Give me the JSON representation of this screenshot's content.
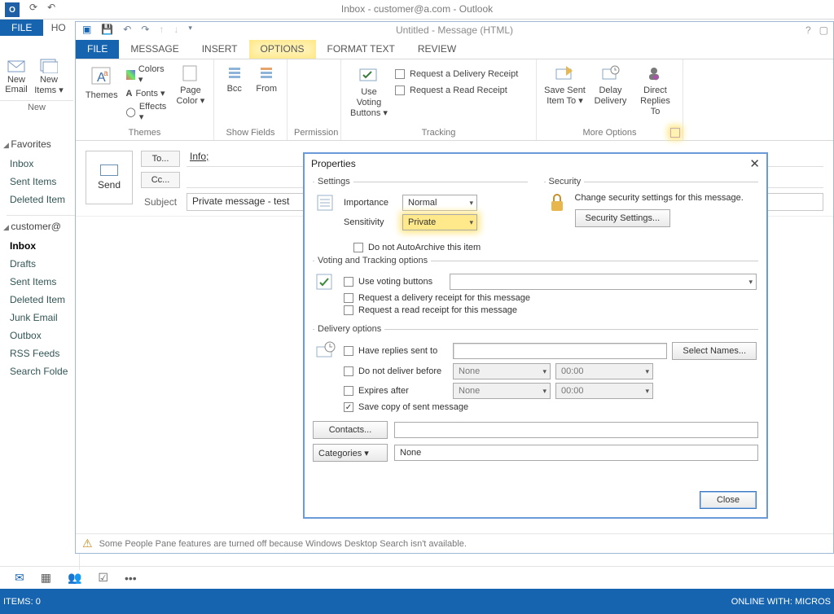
{
  "main_window": {
    "title": "Inbox - customer@a.com - Outlook",
    "file_tab": "FILE",
    "home_tab_fragment": "HO",
    "new_group_label": "New",
    "new_email": "New Email",
    "new_items": "New Items ▾"
  },
  "sidebar": {
    "favorites": "Favorites",
    "fav_items": [
      "Inbox",
      "Sent Items",
      "Deleted Item"
    ],
    "account": "customer@",
    "acct_items": [
      "Inbox",
      "Drafts",
      "Sent Items",
      "Deleted Item",
      "Junk Email",
      "Outbox",
      "RSS Feeds",
      "Search Folde"
    ],
    "selected": "Inbox"
  },
  "statusbar": {
    "left": "ITEMS: 0",
    "right": "ONLINE WITH: MICROS"
  },
  "infobar": "Some People Pane features are turned off because Windows Desktop Search isn't available.",
  "msgwin": {
    "title": "Untitled - Message (HTML)",
    "tabs": {
      "file": "FILE",
      "message": "MESSAGE",
      "insert": "INSERT",
      "options": "OPTIONS",
      "format": "FORMAT TEXT",
      "review": "REVIEW"
    },
    "ribbon": {
      "themes": {
        "themes": "Themes",
        "colors": "Colors ▾",
        "fonts": "Fonts ▾",
        "effects": "Effects ▾",
        "page_color": "Page Color ▾",
        "label": "Themes"
      },
      "showfields": {
        "bcc": "Bcc",
        "from": "From",
        "label": "Show Fields"
      },
      "permission": {
        "label": "Permission"
      },
      "tracking": {
        "voting": "Use Voting Buttons ▾",
        "delivery": "Request a Delivery Receipt",
        "read": "Request a Read Receipt",
        "label": "Tracking"
      },
      "more": {
        "save_sent": "Save Sent Item To ▾",
        "delay": "Delay Delivery",
        "direct": "Direct Replies To",
        "label": "More Options"
      }
    },
    "header": {
      "send": "Send",
      "to": "To...",
      "cc": "Cc...",
      "subject_label": "Subject",
      "to_value": "Info;",
      "cc_value": "",
      "subject_value": "Private message - test"
    }
  },
  "dialog": {
    "title": "Properties",
    "settings_legend": "Settings",
    "security_legend": "Security",
    "importance_label": "Importance",
    "importance_value": "Normal",
    "sensitivity_label": "Sensitivity",
    "sensitivity_value": "Private",
    "autoarchive": "Do not AutoArchive this item",
    "security_text": "Change security settings for this message.",
    "security_button": "Security Settings...",
    "voting_legend": "Voting and Tracking options",
    "use_voting": "Use voting buttons",
    "req_delivery": "Request a delivery receipt for this message",
    "req_read": "Request a read receipt for this message",
    "delivery_legend": "Delivery options",
    "have_replies": "Have replies sent to",
    "select_names": "Select Names...",
    "no_deliver_before": "Do not deliver before",
    "expires_after": "Expires after",
    "none": "None",
    "time": "00:00",
    "save_copy": "Save copy of sent message",
    "contacts": "Contacts...",
    "categories": "Categories   ▾",
    "categories_value": "None",
    "close": "Close"
  }
}
